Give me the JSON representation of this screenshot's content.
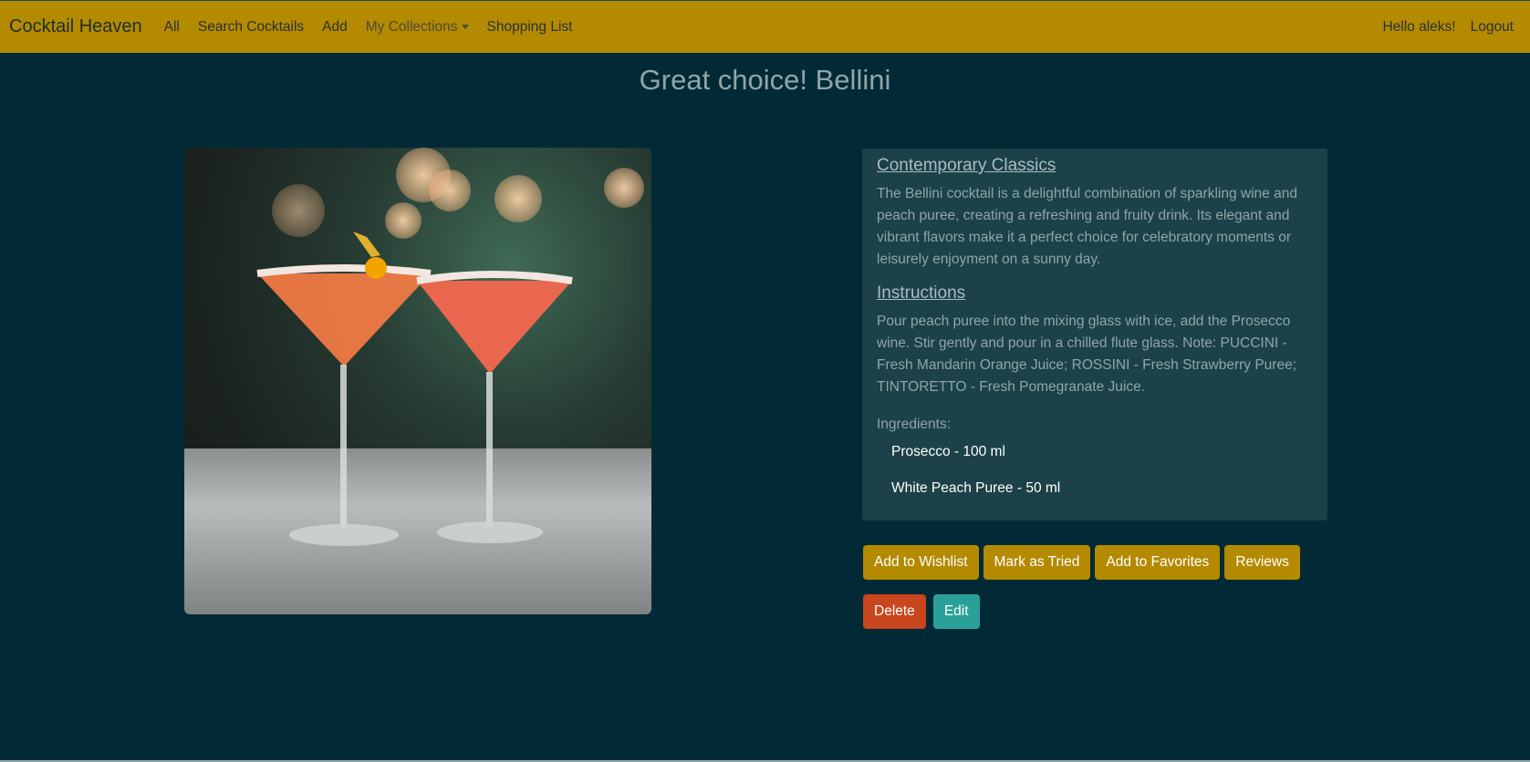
{
  "navbar": {
    "brand": "Cocktail Heaven",
    "links": {
      "all": "All",
      "search": "Search Cocktails",
      "add": "Add",
      "collections": "My Collections",
      "shopping": "Shopping List"
    },
    "greeting": "Hello aleks!",
    "logout": "Logout"
  },
  "page": {
    "title": "Great choice! Bellini"
  },
  "cocktail": {
    "category": "Contemporary Classics",
    "description": "The Bellini cocktail is a delightful combination of sparkling wine and peach puree, creating a refreshing and fruity drink. Its elegant and vibrant flavors make it a perfect choice for celebratory moments or leisurely enjoyment on a sunny day.",
    "instructions_heading": "Instructions",
    "instructions": "Pour peach puree into the mixing glass with ice, add the Prosecco wine. Stir gently and pour in a chilled flute glass. Note: PUCCINI - Fresh Mandarin Orange Juice; ROSSINI - Fresh Strawberry Puree; TINTORETTO - Fresh Pomegranate Juice.",
    "ingredients_label": "Ingredients:",
    "ingredients": [
      "Prosecco - 100 ml",
      "White Peach Puree - 50 ml"
    ]
  },
  "actions": {
    "wishlist": "Add to Wishlist",
    "tried": "Mark as Tried",
    "favorites": "Add to Favorites",
    "reviews": "Reviews",
    "delete": "Delete",
    "edit": "Edit"
  },
  "colors": {
    "background": "#022a36",
    "navbar": "#b38a00",
    "card": "#1c4148",
    "delete": "#c9451e",
    "edit": "#2aa198"
  }
}
